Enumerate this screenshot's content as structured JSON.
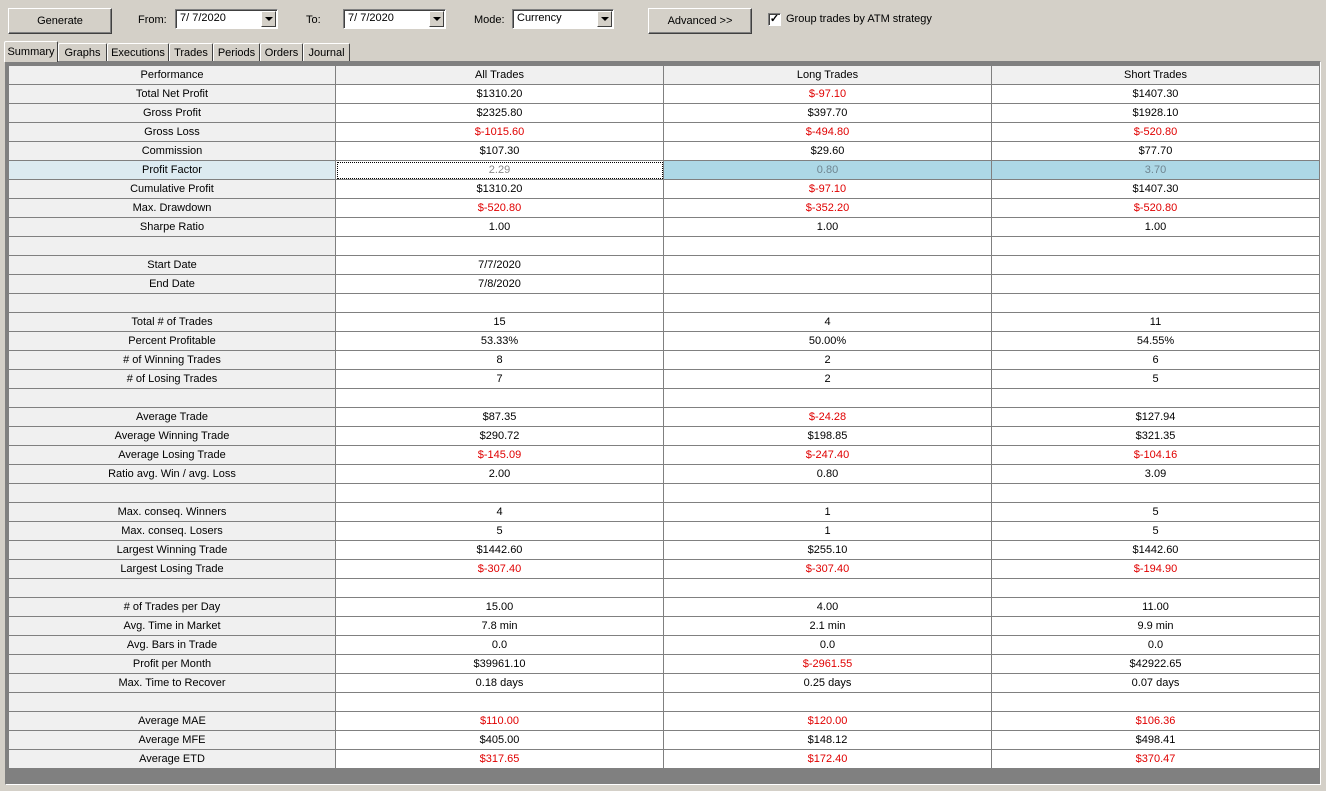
{
  "toolbar": {
    "generate_label": "Generate",
    "from_label": "From:",
    "from_value": "7/ 7/2020",
    "to_label": "To:",
    "to_value": "7/ 7/2020",
    "mode_label": "Mode:",
    "mode_value": "Currency",
    "advanced_label": "Advanced >>",
    "group_label": "Group trades by ATM strategy",
    "group_checked": true
  },
  "tabs": [
    {
      "label": "Summary",
      "active": true
    },
    {
      "label": "Graphs"
    },
    {
      "label": "Executions"
    },
    {
      "label": "Trades"
    },
    {
      "label": "Periods"
    },
    {
      "label": "Orders"
    },
    {
      "label": "Journal"
    }
  ],
  "table": {
    "headers": [
      "Performance",
      "All Trades",
      "Long Trades",
      "Short Trades"
    ],
    "rows": [
      [
        "Total Net Profit",
        "$1310.20",
        "$-97.10",
        "$1407.30"
      ],
      [
        "Gross Profit",
        "$2325.80",
        "$397.70",
        "$1928.10"
      ],
      [
        "Gross Loss",
        "$-1015.60",
        "$-494.80",
        "$-520.80"
      ],
      [
        "Commission",
        "$107.30",
        "$29.60",
        "$77.70"
      ],
      [
        "Profit Factor",
        "2.29",
        "0.80",
        "3.70"
      ],
      [
        "Cumulative Profit",
        "$1310.20",
        "$-97.10",
        "$1407.30"
      ],
      [
        "Max. Drawdown",
        "$-520.80",
        "$-352.20",
        "$-520.80"
      ],
      [
        "Sharpe Ratio",
        "1.00",
        "1.00",
        "1.00"
      ],
      [
        "",
        "",
        "",
        ""
      ],
      [
        "Start Date",
        "7/7/2020",
        "",
        ""
      ],
      [
        "End Date",
        "7/8/2020",
        "",
        ""
      ],
      [
        "",
        "",
        "",
        ""
      ],
      [
        "Total # of Trades",
        "15",
        "4",
        "11"
      ],
      [
        "Percent Profitable",
        "53.33%",
        "50.00%",
        "54.55%"
      ],
      [
        "# of Winning Trades",
        "8",
        "2",
        "6"
      ],
      [
        "# of Losing Trades",
        "7",
        "2",
        "5"
      ],
      [
        "",
        "",
        "",
        ""
      ],
      [
        "Average Trade",
        "$87.35",
        "$-24.28",
        "$127.94"
      ],
      [
        "Average Winning Trade",
        "$290.72",
        "$198.85",
        "$321.35"
      ],
      [
        "Average Losing Trade",
        "$-145.09",
        "$-247.40",
        "$-104.16"
      ],
      [
        "Ratio avg. Win / avg. Loss",
        "2.00",
        "0.80",
        "3.09"
      ],
      [
        "",
        "",
        "",
        ""
      ],
      [
        "Max. conseq. Winners",
        "4",
        "1",
        "5"
      ],
      [
        "Max. conseq. Losers",
        "5",
        "1",
        "5"
      ],
      [
        "Largest Winning Trade",
        "$1442.60",
        "$255.10",
        "$1442.60"
      ],
      [
        "Largest Losing Trade",
        "$-307.40",
        "$-307.40",
        "$-194.90"
      ],
      [
        "",
        "",
        "",
        ""
      ],
      [
        "# of Trades per Day",
        "15.00",
        "4.00",
        "11.00"
      ],
      [
        "Avg. Time in Market",
        "7.8 min",
        "2.1 min",
        "9.9 min"
      ],
      [
        "Avg. Bars in Trade",
        "0.0",
        "0.0",
        "0.0"
      ],
      [
        "Profit per Month",
        "$39961.10",
        "$-2961.55",
        "$42922.65"
      ],
      [
        "Max. Time to Recover",
        "0.18 days",
        "0.25 days",
        "0.07 days"
      ],
      [
        "",
        "",
        "",
        ""
      ],
      [
        "Average MAE",
        "$110.00",
        "$120.00",
        "$106.36"
      ],
      [
        "Average MFE",
        "$405.00",
        "$148.12",
        "$498.41"
      ],
      [
        "Average ETD",
        "$317.65",
        "$172.40",
        "$370.47"
      ]
    ],
    "red_rows": [
      "Gross Loss",
      "Average Losing Trade",
      "Largest Losing Trade",
      "Average MAE",
      "Average ETD"
    ],
    "selected_row": 4,
    "colors": {
      "negative": "#e00000",
      "selected": "#add8e6",
      "header_bg": "#f0f0f0"
    }
  }
}
